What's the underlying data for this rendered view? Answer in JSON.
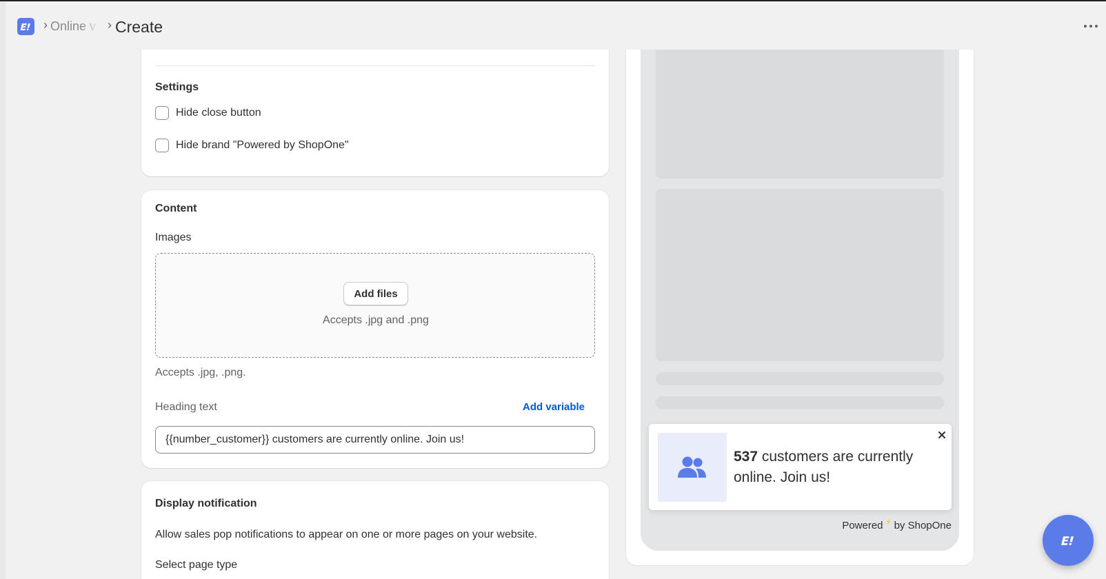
{
  "header": {
    "breadcrumb_parent": "Online v",
    "title": "Create",
    "logo_icon": "app-logo-icon",
    "more_icon": "more-horizontal-icon"
  },
  "settings": {
    "heading": "Settings",
    "options": [
      {
        "label": "Hide close button",
        "checked": false
      },
      {
        "label": "Hide brand \"Powered by ShopOne\"",
        "checked": false
      }
    ]
  },
  "content": {
    "heading": "Content",
    "images_label": "Images",
    "add_files_label": "Add files",
    "dropzone_hint": "Accepts .jpg and .png",
    "accepts_help": "Accepts .jpg, .png.",
    "heading_text_label": "Heading text",
    "add_variable_label": "Add variable",
    "heading_text_value": "{{number_customer}} customers are currently online. Join us!"
  },
  "display": {
    "heading": "Display notification",
    "description": "Allow sales pop notifications to appear on one or more pages on your website.",
    "select_label": "Select page type"
  },
  "preview": {
    "count": "537",
    "message": " customers are currently online. Join us!",
    "icon": "users-icon",
    "powered_prefix": "Powered",
    "powered_suffix": "by ShopOne"
  },
  "colors": {
    "brand": "#5b7be8",
    "link": "#005bd3",
    "bolt": "#f2b705"
  }
}
